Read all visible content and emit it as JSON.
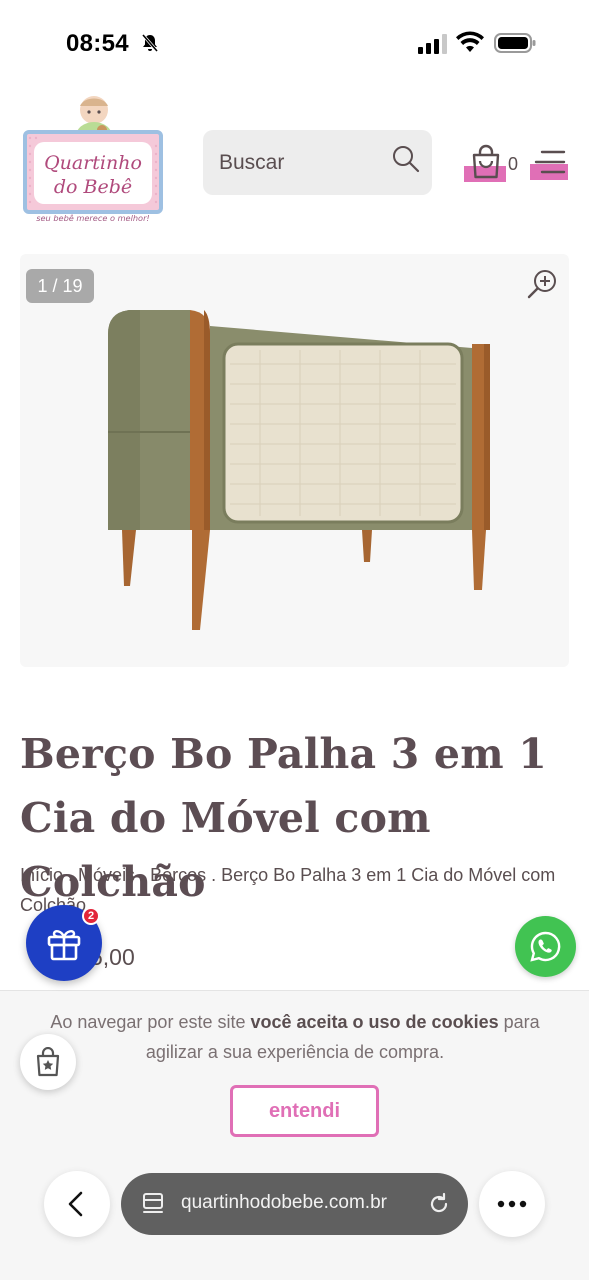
{
  "status_bar": {
    "time": "08:54",
    "icons": [
      "bell-off-icon",
      "signal-icon",
      "wifi-icon",
      "battery-icon"
    ]
  },
  "header": {
    "logo": {
      "line1": "Quartinho",
      "line2": "do Bebê",
      "tagline": "seu bebê merece o melhor!"
    },
    "search": {
      "placeholder": "Buscar",
      "value": ""
    },
    "cart_count": "0"
  },
  "gallery": {
    "counter": "1 / 19"
  },
  "product": {
    "title": "Berço Bo Palha 3 em 1 Cia do Móvel com Colchão",
    "price_visible_fragment": "6,00"
  },
  "breadcrumb": [
    "Início",
    "Móveis",
    "Berços",
    "Berço Bo Palha 3 em 1 Cia do Móvel com Colchão"
  ],
  "gift_badge": "2",
  "cookie_banner": {
    "text_before": "Ao navegar por este site ",
    "text_bold": "você aceita o uso de cookies",
    "text_after": " para agilizar a sua experiência de compra.",
    "button": "entendi"
  },
  "browser": {
    "url": "quartinhodobebe.com.br"
  },
  "colors": {
    "accent_pink": "#e06fb6",
    "gift_blue": "#1e3fc4",
    "whatsapp_green": "#41c352",
    "text": "#5a4e50"
  }
}
